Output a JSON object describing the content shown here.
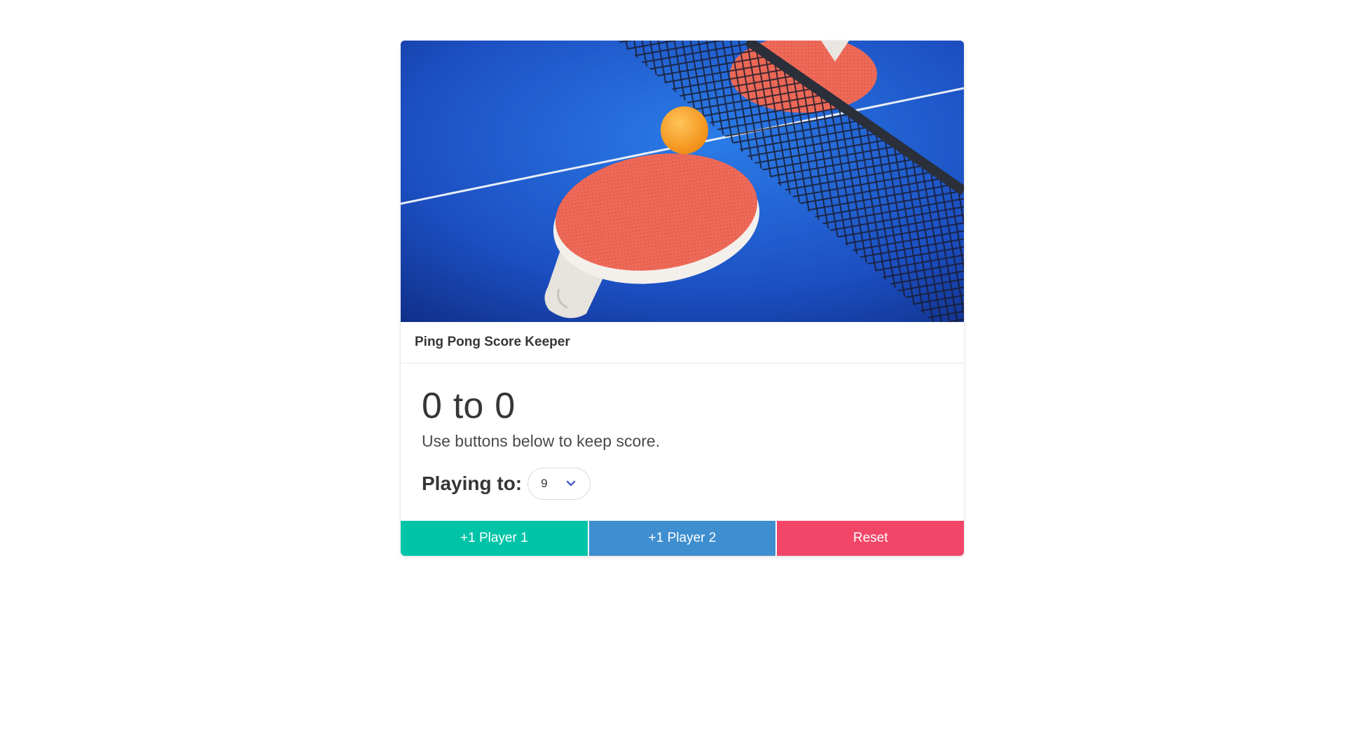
{
  "card": {
    "image_alt": "ping pong paddles, ball and net on a blue table",
    "title": "Ping Pong Score Keeper"
  },
  "score": {
    "player1": "0",
    "separator": "to",
    "player2": "0"
  },
  "subtitle": "Use buttons below to keep score.",
  "playing_to": {
    "label": "Playing to:",
    "selected": "9"
  },
  "buttons": {
    "player1": "+1 Player 1",
    "player2": "+1 Player 2",
    "reset": "Reset"
  },
  "colors": {
    "player1": "#00c4a7",
    "player2": "#3e8ed0",
    "reset": "#f14668",
    "select_chevron": "#485fc7"
  },
  "icons": {
    "select_arrow": "chevron-down-icon"
  }
}
